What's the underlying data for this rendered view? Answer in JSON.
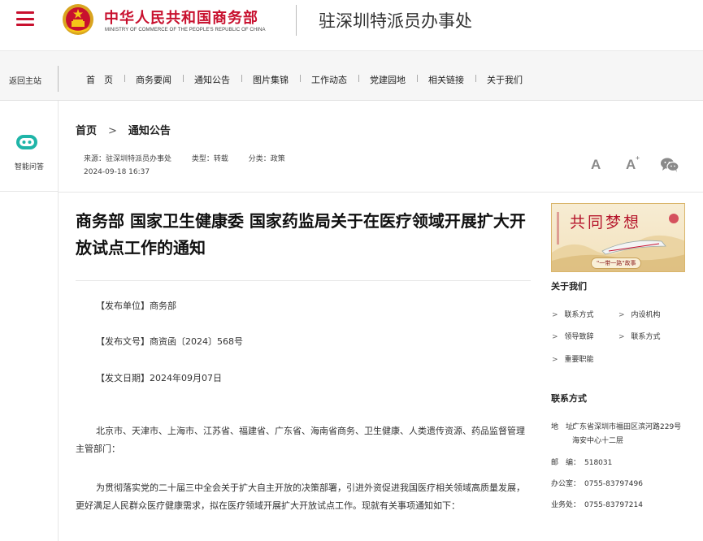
{
  "header": {
    "ministry_cn": "中华人民共和国商务部",
    "ministry_en": "MINISTRY OF COMMERCE OF THE PEOPLE'S REPUBLIC OF CHINA",
    "office_name": "驻深圳特派员办事处"
  },
  "nav": {
    "back_home": "返回主站",
    "items": [
      "首　页",
      "商务要闻",
      "通知公告",
      "图片集锦",
      "工作动态",
      "党建园地",
      "相关链接",
      "关于我们"
    ]
  },
  "left_rail": {
    "assistant_label": "智能问答"
  },
  "breadcrumb": {
    "home": "首页",
    "separator": ">",
    "current": "通知公告"
  },
  "meta": {
    "source": "来源：驻深圳特派员办事处",
    "type": "类型：转载",
    "category": "分类：政策",
    "datetime": "2024-09-18 16:37"
  },
  "tools": {
    "font_small": "A",
    "font_large": "A",
    "font_large_sup": "+"
  },
  "article": {
    "title": "商务部 国家卫生健康委 国家药监局关于在医疗领域开展扩大开放试点工作的通知",
    "issuer": "【发布单位】商务部",
    "doc_no": "【发布文号】商资函〔2024〕568号",
    "issue_date": "【发文日期】2024年09月07日",
    "body1": "北京市、天津市、上海市、江苏省、福建省、广东省、海南省商务、卫生健康、人类遗传资源、药品监督管理主管部门：",
    "body2": "为贯彻落实党的二十届三中全会关于扩大自主开放的决策部署，引进外资促进我国医疗相关领域高质量发展，更好满足人民群众医疗健康需求，拟在医疗领域开展扩大开放试点工作。现就有关事项通知如下："
  },
  "sidebar": {
    "banner_title": "共同梦想",
    "banner_sub": "\"一带一路\"故事",
    "about_heading": "关于我们",
    "about_links": [
      "联系方式",
      "内设机构",
      "领导致辞",
      "联系方式",
      "重要职能"
    ],
    "link_arrow": ">",
    "contact_heading": "联系方式",
    "address_label": "地　址：",
    "address": "广东省深圳市福田区滨河路229号　海安中心十二层",
    "zip_label": "邮　编：",
    "zip": "518031",
    "office_label": "办公室：",
    "office_phone": "0755-83797496",
    "business_label": "业务处：",
    "business_phone": "0755-83797214"
  },
  "colors": {
    "brand_red": "#c8102e",
    "assistant_teal": "#1fb5a8",
    "banner_gold": "#d9b56a"
  },
  "icons": {
    "menu": "hamburger-menu-icon",
    "emblem": "national-emblem-icon",
    "assistant": "chatbot-icon",
    "wechat": "wechat-share-icon"
  }
}
